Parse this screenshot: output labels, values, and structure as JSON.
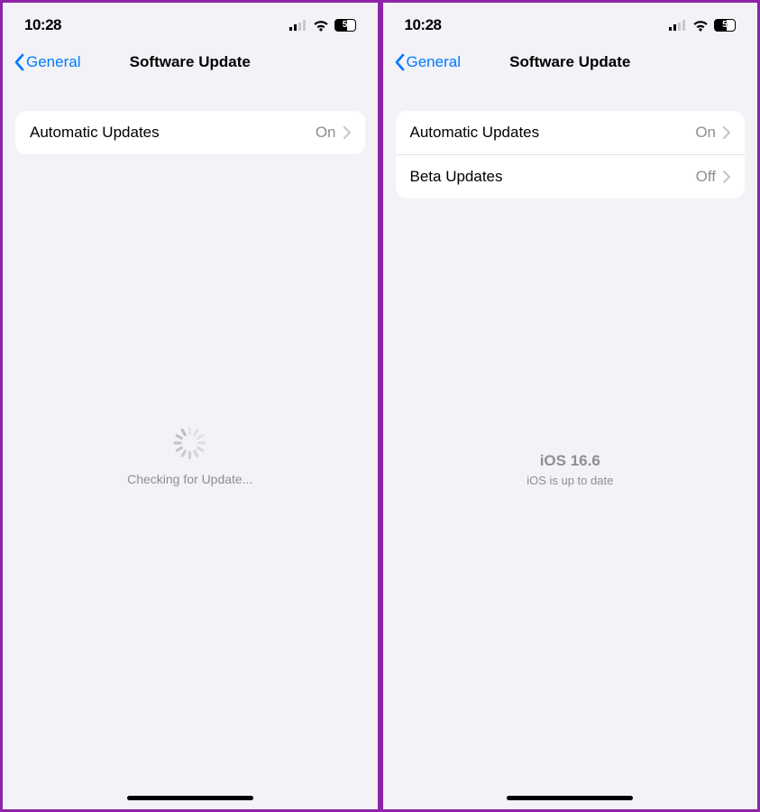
{
  "left": {
    "status": {
      "time": "10:28",
      "battery": "5"
    },
    "nav": {
      "back_label": "General",
      "title": "Software Update"
    },
    "list": [
      {
        "label": "Automatic Updates",
        "value": "On"
      }
    ],
    "checking_text": "Checking for Update..."
  },
  "right": {
    "status": {
      "time": "10:28",
      "battery": "5"
    },
    "nav": {
      "back_label": "General",
      "title": "Software Update"
    },
    "list": [
      {
        "label": "Automatic Updates",
        "value": "On"
      },
      {
        "label": "Beta Updates",
        "value": "Off"
      }
    ],
    "version": {
      "title": "iOS 16.6",
      "subtitle": "iOS is up to date"
    }
  }
}
